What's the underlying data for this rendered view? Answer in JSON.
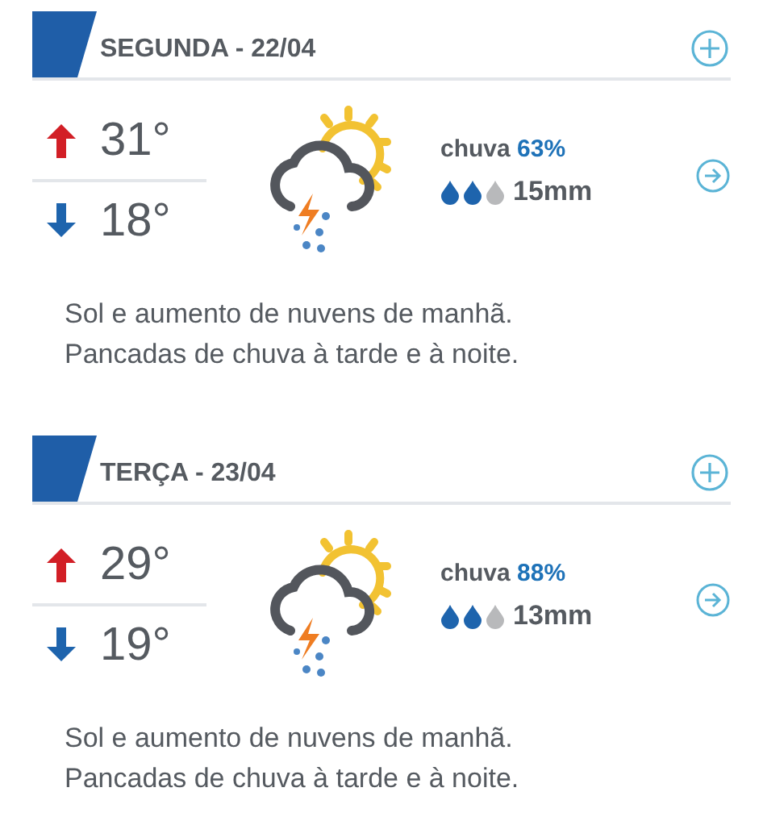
{
  "days": [
    {
      "title": "SEGUNDA - 22/04",
      "max": "31°",
      "min": "18°",
      "rain_label": "chuva",
      "rain_chance": "63%",
      "drops": [
        {
          "filled": true
        },
        {
          "filled": true
        },
        {
          "filled": false
        }
      ],
      "rain_amount": "15mm",
      "description": "Sol e aumento de nuvens de manhã.\nPancadas de chuva à tarde e à noite."
    },
    {
      "title": "TERÇA - 23/04",
      "max": "29°",
      "min": "19°",
      "rain_label": "chuva",
      "rain_chance": "88%",
      "drops": [
        {
          "filled": true
        },
        {
          "filled": true
        },
        {
          "filled": false
        }
      ],
      "rain_amount": "13mm",
      "description": "Sol e aumento de nuvens de manhã.\nPancadas de chuva à tarde e à noite."
    }
  ]
}
